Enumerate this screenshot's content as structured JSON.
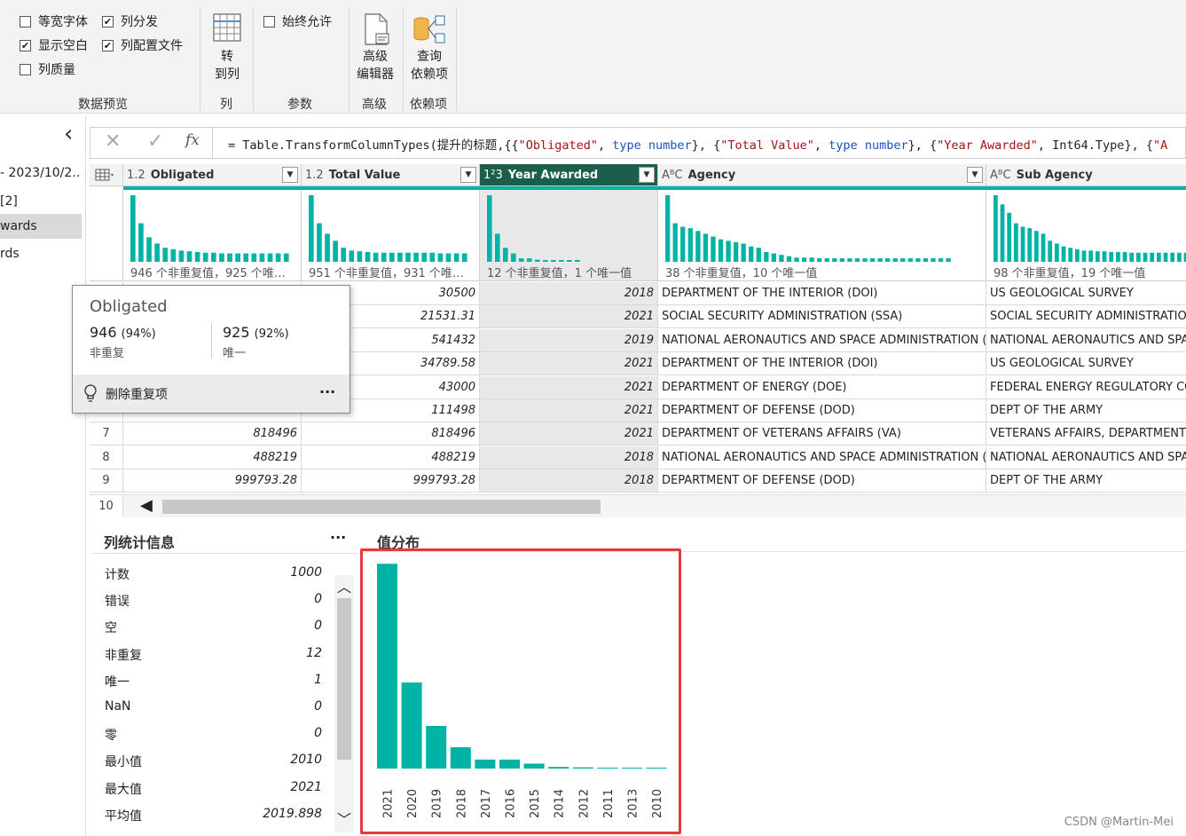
{
  "ribbon": {
    "checks": [
      {
        "label": "等宽字体",
        "checked": false
      },
      {
        "label": "列分发",
        "checked": true
      },
      {
        "label": "显示空白",
        "checked": true
      },
      {
        "label": "列配置文件",
        "checked": true
      },
      {
        "label": "列质量",
        "checked": false
      },
      {
        "label": "始终允许",
        "checked": false
      }
    ],
    "groups": {
      "preview": "数据预览",
      "column": "列",
      "param": "参数",
      "advanced": "高级",
      "deps": "依赖项"
    },
    "buttons": {
      "to_column": [
        "转",
        "到列"
      ],
      "adv_editor": [
        "高级",
        "编辑器"
      ],
      "query_deps": [
        "查询",
        "依赖项"
      ]
    }
  },
  "left_pane": {
    "collapse_glyph": "‹",
    "items": [
      "- 2023/10/2…",
      "[2]",
      "wards",
      "rds"
    ]
  },
  "formula": {
    "fx": "fx",
    "prefix": "= Table.TransformColumnTypes(提升的标题,{{",
    "s1": "\"Obligated\"",
    "t1": "type",
    "n1": "number",
    "mid1": "}, {",
    "s2": "\"Total Value\"",
    "t2": "type",
    "n2": "number",
    "mid2": "}, {",
    "s3": "\"Year Awarded\"",
    "mid3": ", Int64.Type}, {",
    "s4": "\"A"
  },
  "columns": [
    {
      "type": "1.2",
      "name": "Obligated",
      "caption": "946 个非重复值，925 个唯…"
    },
    {
      "type": "1.2",
      "name": "Total Value",
      "caption": "951 个非重复值，931 个唯…"
    },
    {
      "type": "1²3",
      "name": "Year Awarded",
      "caption": "12 个非重复值，1 个唯一值"
    },
    {
      "type": "AᴮC",
      "name": "Agency",
      "caption": "38 个非重复值，10 个唯一值"
    },
    {
      "type": "AᴮC",
      "name": "Sub Agency",
      "caption": "98 个非重复值，19 个唯一值"
    }
  ],
  "rows": [
    {
      "n": "",
      "a": "",
      "b": "30500",
      "c": "2018",
      "d": "DEPARTMENT OF THE INTERIOR (DOI)",
      "e": "US GEOLOGICAL SURVEY"
    },
    {
      "n": "",
      "a": "",
      "b": "21531.31",
      "c": "2021",
      "d": "SOCIAL SECURITY ADMINISTRATION (SSA)",
      "e": "SOCIAL SECURITY ADMINISTRATION"
    },
    {
      "n": "",
      "a": "",
      "b": "541432",
      "c": "2019",
      "d": "NATIONAL AERONAUTICS AND SPACE ADMINISTRATION (…",
      "e": "NATIONAL AERONAUTICS AND SPAC"
    },
    {
      "n": "",
      "a": "",
      "b": "34789.58",
      "c": "2021",
      "d": "DEPARTMENT OF THE INTERIOR (DOI)",
      "e": "US GEOLOGICAL SURVEY"
    },
    {
      "n": "",
      "a": "",
      "b": "43000",
      "c": "2021",
      "d": "DEPARTMENT OF ENERGY (DOE)",
      "e": "FEDERAL ENERGY REGULATORY COM"
    },
    {
      "n": "",
      "a": "",
      "b": "111498",
      "c": "2021",
      "d": "DEPARTMENT OF DEFENSE (DOD)",
      "e": "DEPT OF THE ARMY"
    },
    {
      "n": "7",
      "a": "818496",
      "b": "818496",
      "c": "2021",
      "d": "DEPARTMENT OF VETERANS AFFAIRS (VA)",
      "e": "VETERANS AFFAIRS, DEPARTMENT C"
    },
    {
      "n": "8",
      "a": "488219",
      "b": "488219",
      "c": "2018",
      "d": "NATIONAL AERONAUTICS AND SPACE ADMINISTRATION (…",
      "e": "NATIONAL AERONAUTICS AND SPAC"
    },
    {
      "n": "9",
      "a": "999793.28",
      "b": "999793.28",
      "c": "2018",
      "d": "DEPARTMENT OF DEFENSE (DOD)",
      "e": "DEPT OF THE ARMY"
    }
  ],
  "row10": "10",
  "popup": {
    "title": "Obligated",
    "distinct_val": "946",
    "distinct_pct": "(94%)",
    "distinct_label": "非重复",
    "unique_val": "925",
    "unique_pct": "(92%)",
    "unique_label": "唯一",
    "action": "删除重复项",
    "more": "···"
  },
  "stats": {
    "title": "列统计信息",
    "more": "···",
    "rows": [
      {
        "k": "计数",
        "v": "1000"
      },
      {
        "k": "错误",
        "v": "0"
      },
      {
        "k": "空",
        "v": "0"
      },
      {
        "k": "非重复",
        "v": "12"
      },
      {
        "k": "唯一",
        "v": "1"
      },
      {
        "k": "NaN",
        "v": "0"
      },
      {
        "k": "零",
        "v": "0"
      },
      {
        "k": "最小值",
        "v": "2010"
      },
      {
        "k": "最大值",
        "v": "2021"
      },
      {
        "k": "平均值",
        "v": "2019.898"
      }
    ]
  },
  "distribution": {
    "title": "值分布"
  },
  "watermark": "CSDN @Martin-Mei",
  "colors": {
    "accent": "#00b3a4",
    "selected_header": "#1b5e4b",
    "highlight": "#e23b3b"
  },
  "chart_data": {
    "type": "bar",
    "categories": [
      "2021",
      "2020",
      "2019",
      "2018",
      "2017",
      "2016",
      "2015",
      "2014",
      "2012",
      "2011",
      "2013",
      "2010"
    ],
    "values": [
      500,
      210,
      104,
      52,
      22,
      22,
      12,
      4,
      3,
      2,
      1,
      1
    ],
    "ylim": [
      0,
      520
    ],
    "grid": false
  },
  "mini_hist": {
    "obligated": [
      95,
      55,
      35,
      26,
      20,
      18,
      16,
      15,
      14,
      13,
      13,
      12,
      12,
      12,
      12,
      12,
      12,
      12,
      12,
      12
    ],
    "total_value": [
      95,
      55,
      40,
      30,
      20,
      16,
      15,
      14,
      13,
      13,
      13,
      13,
      13,
      13,
      13,
      13,
      12,
      12,
      12,
      12
    ],
    "year": [
      95,
      40,
      20,
      12,
      5,
      5,
      3,
      2,
      2,
      2,
      2,
      2
    ],
    "agency": [
      95,
      55,
      50,
      48,
      44,
      40,
      36,
      32,
      30,
      28,
      26,
      22,
      20,
      14,
      12,
      10,
      8,
      6,
      6,
      6,
      5,
      5,
      5,
      5,
      5,
      5,
      5,
      5,
      5,
      5,
      5,
      5,
      5,
      5,
      5,
      5,
      5,
      5
    ],
    "subagency": [
      95,
      82,
      70,
      55,
      50,
      48,
      44,
      40,
      30,
      26,
      22,
      20,
      18,
      16,
      16,
      15,
      15,
      14,
      14,
      14,
      13,
      13,
      13,
      13,
      13,
      13,
      13,
      13,
      13,
      13
    ]
  }
}
